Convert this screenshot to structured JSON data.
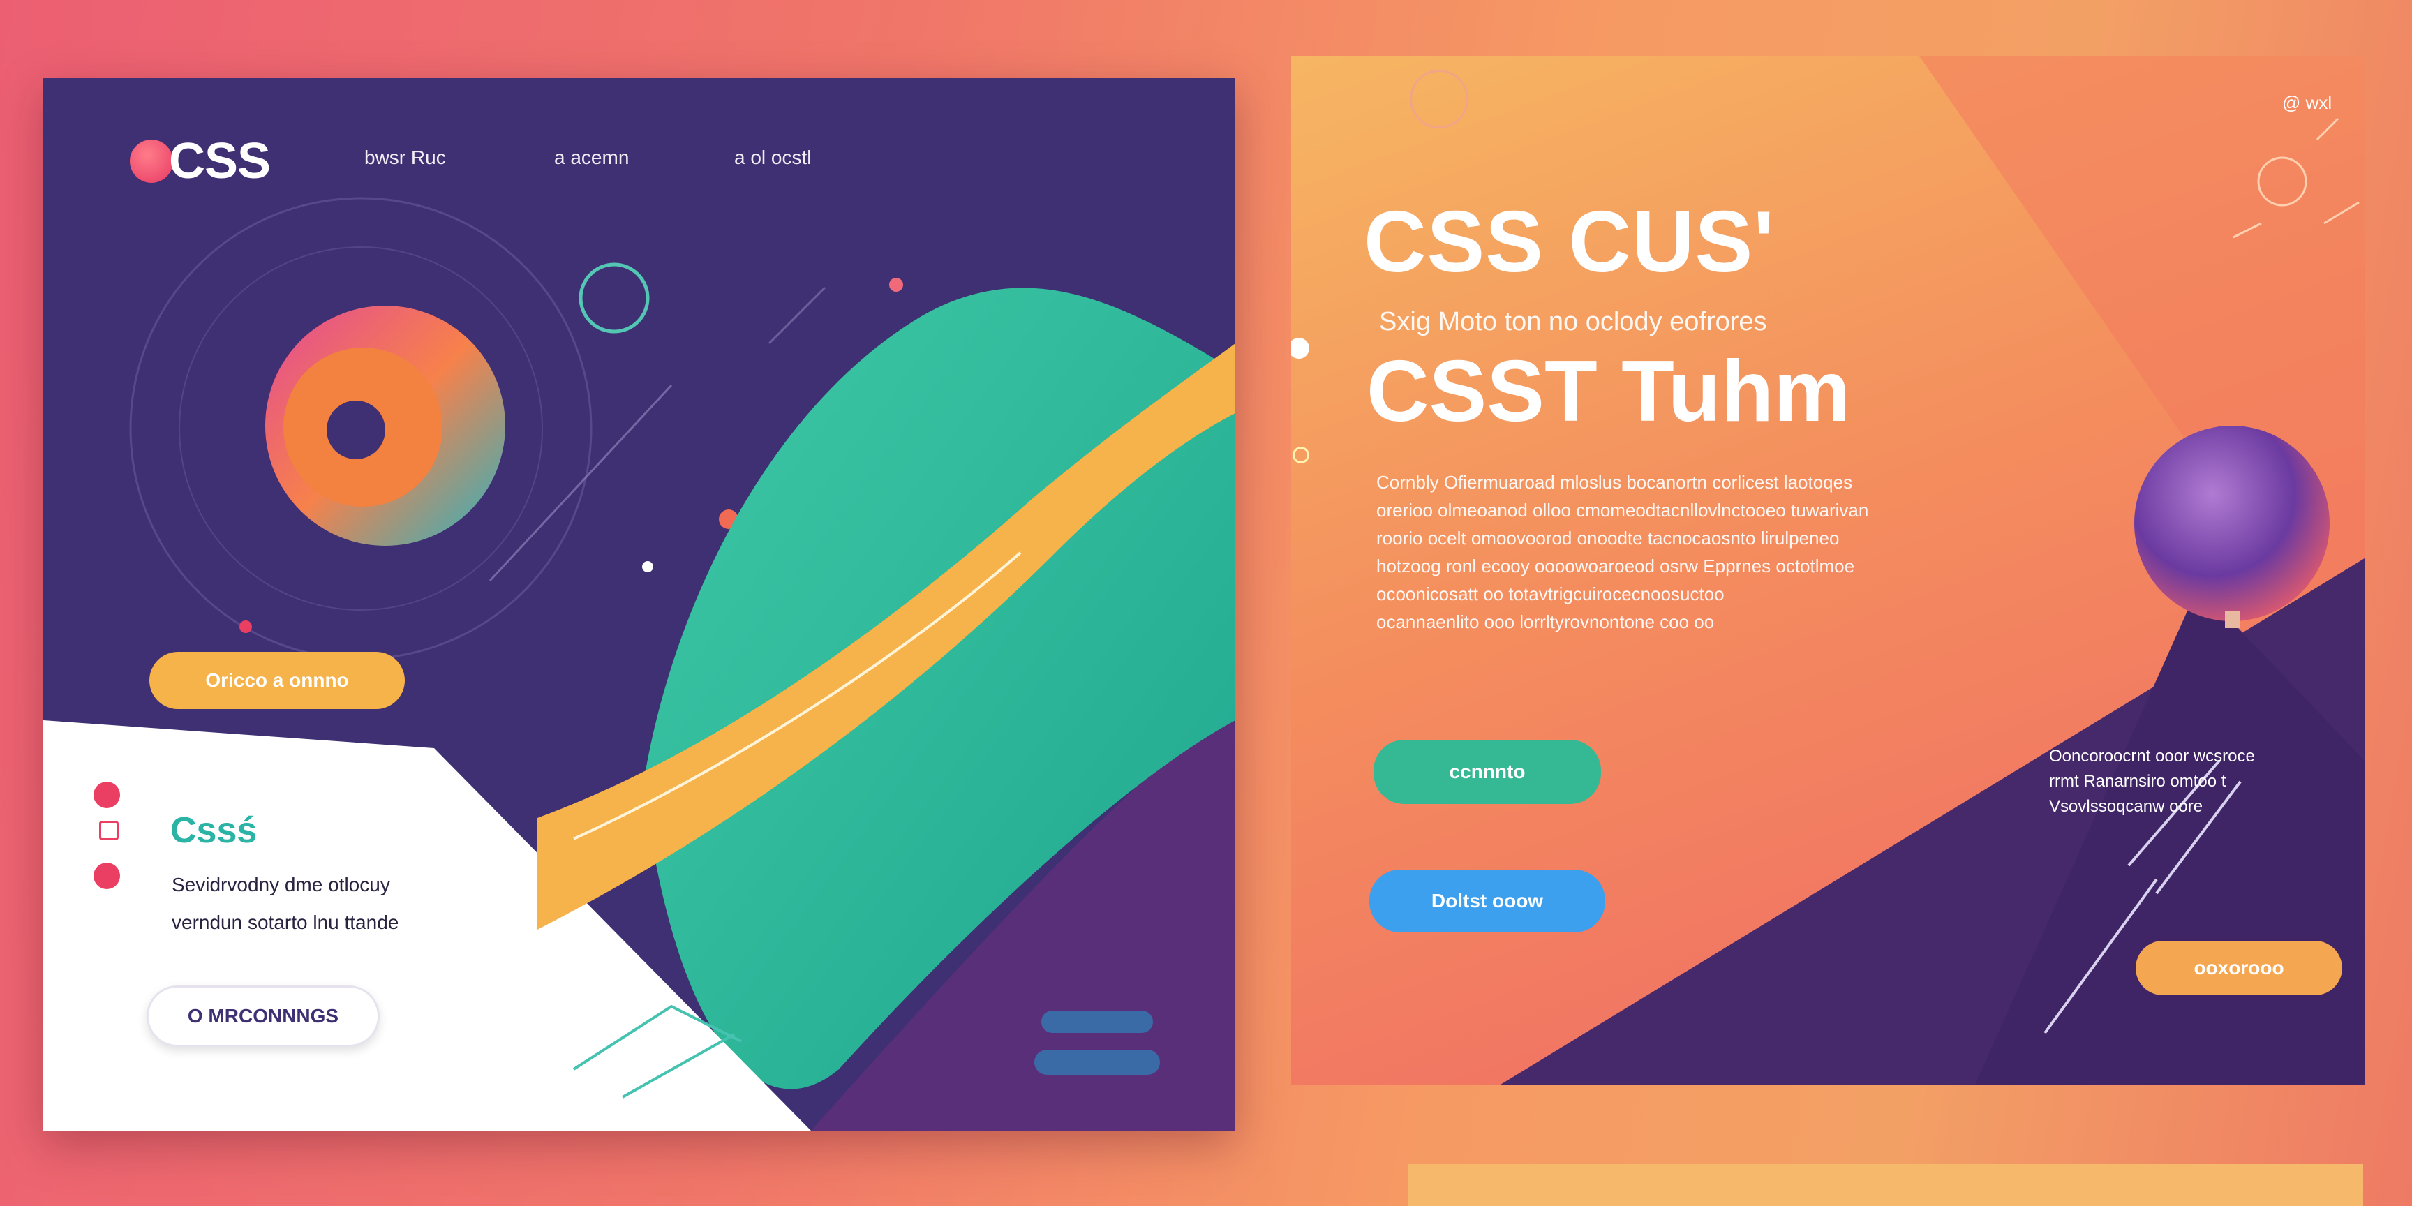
{
  "left": {
    "logo": "CSS",
    "nav": [
      "bwsr Ruc",
      "a acemn",
      "a ol ocstl"
    ],
    "cta_label": "Oricco a onnno",
    "white_title": "Cssś",
    "white_body": [
      "Sevidrvodny dme otlocuy",
      "verndun sotarto lnu ttande"
    ],
    "white_button": "O MRCONNNGS"
  },
  "right": {
    "top_link": "@ wxl",
    "title_line_1": "CSS CUS'",
    "subtitle": "Sxig Moto ton no oclody eofrores",
    "title_line_2": "CSST Tuhm",
    "paragraph": [
      "Cornbly Ofiermuaroad mloslus bocanortn corlicest laotoqes",
      "orerioo olmeoanod olloo cmomeodtacnllovlnctooeo tuwarivan",
      "roorio ocelt omoovoorod onoodte tacnocaosnto lirulpeneo",
      "hotzoog ronl ecooy oooowoaroeod osrw Epprnes octotlmoe",
      "ocoonicosatt oo totavtrigcuirocecnoosuctoo",
      "ocannaenlito ooo lorrltyrovnontone coo oo"
    ],
    "button_teal": "ccnnnto",
    "button_blue": "Doltst ooow",
    "button_orange": "ooxorooo",
    "side_text": [
      "Ooncoroocrnt ooor wcsroce",
      "rrmt Ranarnsiro omtoo t",
      "Vsovlssoqcanw oore"
    ]
  }
}
